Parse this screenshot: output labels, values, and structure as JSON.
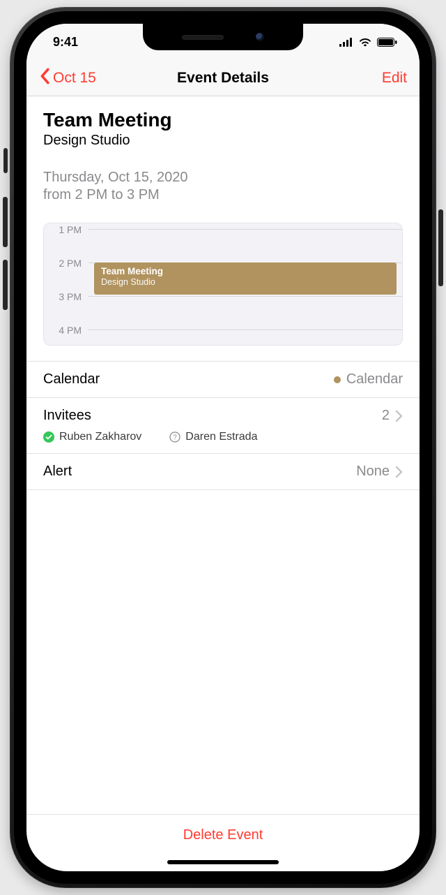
{
  "status": {
    "time": "9:41"
  },
  "nav": {
    "back_label": "Oct 15",
    "title": "Event Details",
    "edit_label": "Edit"
  },
  "event": {
    "title": "Team Meeting",
    "location": "Design Studio",
    "date_line": "Thursday, Oct 15, 2020",
    "time_line": "from 2 PM to 3 PM"
  },
  "timeline": {
    "hours": [
      "1 PM",
      "2 PM",
      "3 PM",
      "4 PM"
    ],
    "block": {
      "title": "Team Meeting",
      "location": "Design Studio"
    }
  },
  "rows": {
    "calendar": {
      "label": "Calendar",
      "value": "Calendar",
      "color": "#b0935f"
    },
    "invitees": {
      "label": "Invitees",
      "count": "2",
      "people": [
        {
          "name": "Ruben Zakharov",
          "status": "accepted"
        },
        {
          "name": "Daren Estrada",
          "status": "pending"
        }
      ]
    },
    "alert": {
      "label": "Alert",
      "value": "None"
    }
  },
  "footer": {
    "delete_label": "Delete Event"
  }
}
